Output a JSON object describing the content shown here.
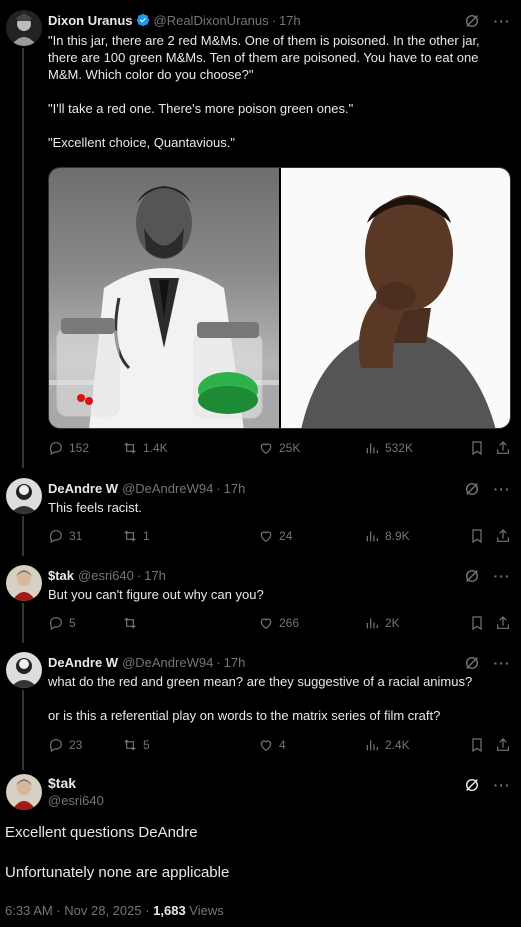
{
  "tweets": [
    {
      "name": "Dixon Uranus",
      "handle": "@RealDixonUranus",
      "time": "17h",
      "text": "\"In this jar, there are 2 red M&Ms. One of them is poisoned. In the other jar, there are 100 green M&Ms. Ten of them are poisoned. You have to eat one M&M. Which color do you choose?\"\n\n\"I'll take a red one. There's more poison green ones.\"\n\n\"Excellent choice, Quantavious.\"",
      "replies": "152",
      "reposts": "1.4K",
      "likes": "25K",
      "views": "532K"
    },
    {
      "name": "DeAndre W",
      "handle": "@DeAndreW94",
      "time": "17h",
      "text": "This feels racist.",
      "replies": "31",
      "reposts": "1",
      "likes": "24",
      "views": "8.9K"
    },
    {
      "name": "$tak",
      "handle": "@esri640",
      "time": "17h",
      "text": "But you can't figure out why can you?",
      "replies": "5",
      "reposts": "",
      "likes": "266",
      "views": "2K"
    },
    {
      "name": "DeAndre W",
      "handle": "@DeAndreW94",
      "time": "17h",
      "text": "what do the red and green mean? are they suggestive of a racial animus?\n\nor is this a referential play on words to the matrix series of film craft?",
      "replies": "23",
      "reposts": "5",
      "likes": "4",
      "views": "2.4K"
    }
  ],
  "main": {
    "name": "$tak",
    "handle": "@esri640",
    "text": "Excellent questions DeAndre\n\nUnfortunately none are applicable",
    "timestamp": "6:33 AM · Nov 28, 2025 · ",
    "view_count": "1,683",
    "views_label": " Views"
  },
  "separator": "·",
  "colors": {
    "background": "#000000",
    "text": "#e7e9ea",
    "secondary": "#71767b",
    "verified": "#1d9bf0",
    "thread_line": "#333639"
  },
  "icons": [
    "verified-badge-icon",
    "grok-icon",
    "more-icon",
    "reply-icon",
    "repost-icon",
    "like-icon",
    "views-icon",
    "bookmark-icon",
    "share-icon"
  ]
}
